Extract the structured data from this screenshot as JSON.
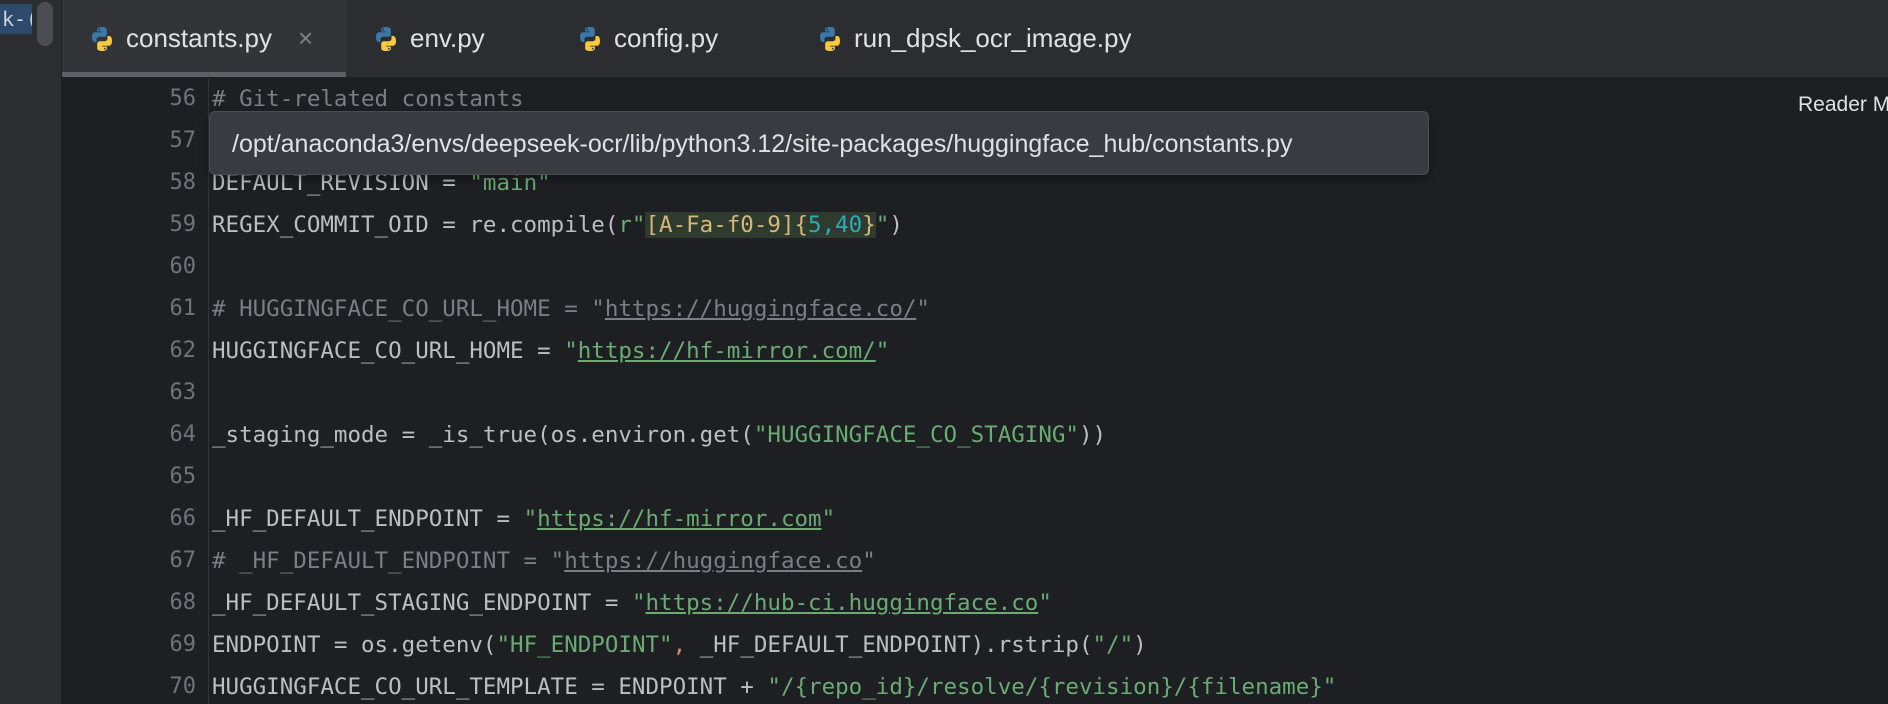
{
  "left_strip": {
    "peek_text": "k-("
  },
  "tabs": [
    {
      "label": "constants.py",
      "active": true,
      "closable": true,
      "close_glyph": "×"
    },
    {
      "label": "env.py",
      "active": false
    },
    {
      "label": "config.py",
      "active": false
    },
    {
      "label": "run_dpsk_ocr_image.py",
      "active": false
    }
  ],
  "tooltip": {
    "path": "/opt/anaconda3/envs/deepseek-ocr/lib/python3.12/site-packages/huggingface_hub/constants.py"
  },
  "reader_mode": {
    "label": "Reader M"
  },
  "editor": {
    "line_numbers": [
      "56",
      "57",
      "58",
      "59",
      "60",
      "61",
      "62",
      "63",
      "64",
      "65",
      "66",
      "67",
      "68",
      "69",
      "70"
    ],
    "lines": {
      "l56": {
        "comment": "# Git-related constants"
      },
      "l58": {
        "ident": "DEFAULT_REVISION = ",
        "str": "\"main\""
      },
      "l59": {
        "pre": "REGEX_COMMIT_OID = re.compile(",
        "prefix": "r\"",
        "rx_class": "[A-Fa-f0-9]",
        "rx_open": "{",
        "rx_n1": "5",
        "rx_comma": ",",
        "rx_n2": "40",
        "rx_close": "}",
        "str_end": "\"",
        "post": ")"
      },
      "l61": {
        "comment_pre": "# HUGGINGFACE_CO_URL_HOME = \"",
        "url": "https://huggingface.co/",
        "comment_post": "\""
      },
      "l62": {
        "ident": "HUGGINGFACE_CO_URL_HOME = ",
        "q1": "\"",
        "url": "https://hf-mirror.com/",
        "q2": "\""
      },
      "l64": {
        "pre": "_staging_mode = _is_true(os.environ.get(",
        "str": "\"HUGGINGFACE_CO_STAGING\"",
        "post": "))"
      },
      "l66": {
        "ident": "_HF_DEFAULT_ENDPOINT = ",
        "q1": "\"",
        "url": "https://hf-mirror.com",
        "q2": "\""
      },
      "l67": {
        "comment_pre": "# _HF_DEFAULT_ENDPOINT = \"",
        "url": "https://huggingface.co",
        "comment_post": "\""
      },
      "l68": {
        "ident": "_HF_DEFAULT_STAGING_ENDPOINT = ",
        "q1": "\"",
        "url": "https://hub-ci.huggingface.co",
        "q2": "\""
      },
      "l69": {
        "pre": "ENDPOINT = os.getenv(",
        "str1": "\"HF_ENDPOINT\"",
        "comma": ", ",
        "mid": "_HF_DEFAULT_ENDPOINT).rstrip(",
        "str2": "\"/\"",
        "post": ")"
      },
      "l70": {
        "pre": "HUGGINGFACE_CO_URL_TEMPLATE = ENDPOINT + ",
        "str": "\"/{repo_id}/resolve/{revision}/{filename}\""
      }
    }
  },
  "colors": {
    "background": "#1e1f22",
    "string": "#6aab73",
    "comment": "#7a7e85",
    "number": "#2aacb8",
    "keyword_orange": "#cf8e6d"
  }
}
